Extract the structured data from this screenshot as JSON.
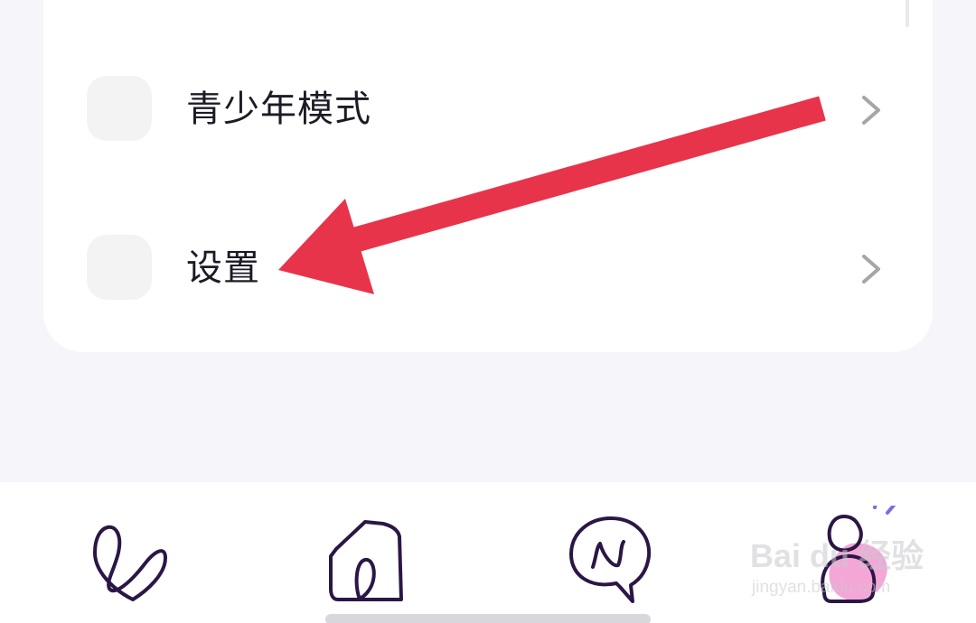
{
  "menu": {
    "items": [
      {
        "label": "青少年模式",
        "icon": "youth-mode-icon",
        "chevron": "chevron-right-icon"
      },
      {
        "label": "设置",
        "icon": "settings-icon",
        "chevron": "chevron-right-icon"
      }
    ]
  },
  "tabbar": {
    "tabs": [
      {
        "icon": "heart-swirl-icon",
        "active": false
      },
      {
        "icon": "house-icon",
        "active": false
      },
      {
        "icon": "chat-bubble-n-icon",
        "active": false
      },
      {
        "icon": "profile-person-icon",
        "active": true
      }
    ],
    "active_color": "#f4a6d7",
    "icon_color": "#2b1745"
  },
  "annotation": {
    "arrow_color": "#e8344a"
  },
  "watermark": {
    "brand": "Bai du 经验",
    "sub": "jingyan.baidu.com"
  },
  "colors": {
    "background": "#f6f5fa",
    "card": "#ffffff",
    "text": "#1c1b25",
    "chevron": "#a6a6a6"
  }
}
